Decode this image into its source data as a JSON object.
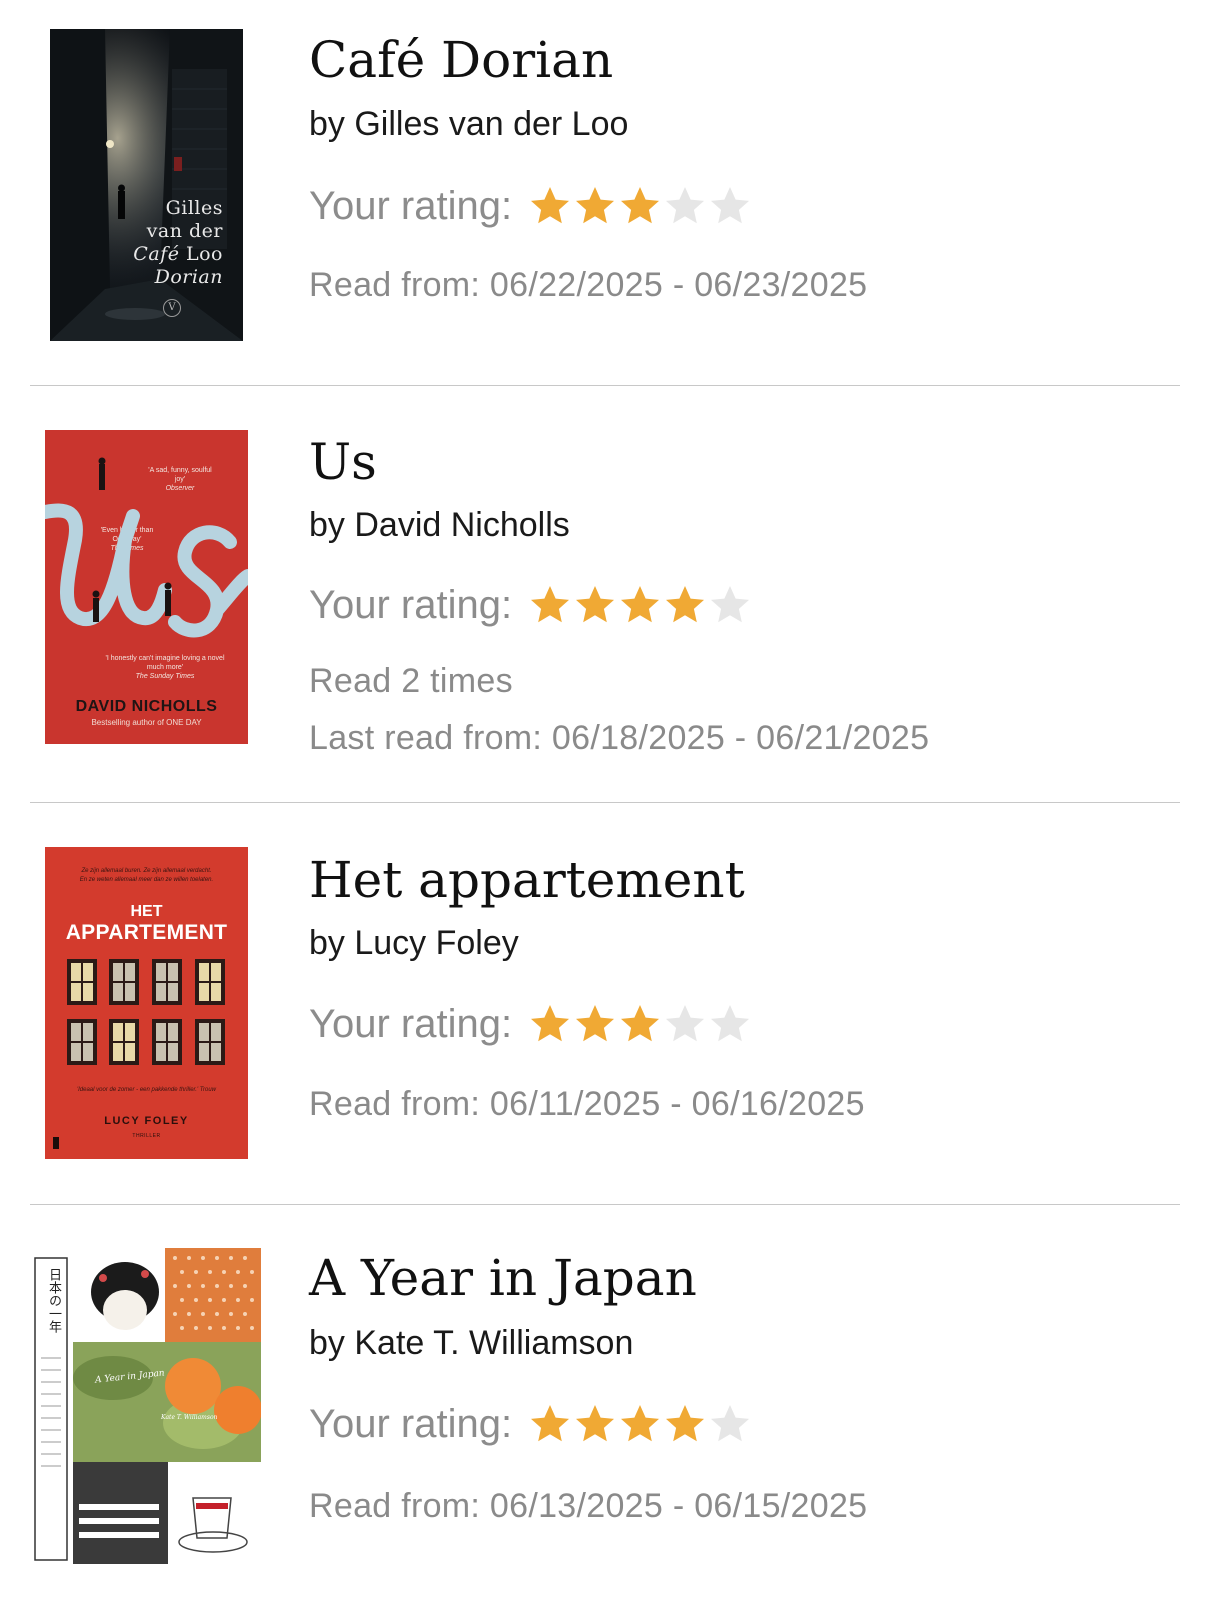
{
  "colors": {
    "star_filled": "#f0a934",
    "star_empty": "#e6e6e6",
    "divider": "#c8c8c8"
  },
  "books": [
    {
      "title": "Café Dorian",
      "author": "by Gilles van der Loo",
      "rating_label": "Your rating:",
      "rating": 3,
      "rating_max": 5,
      "read_info": "Read from: 06/22/2025 - 06/23/2025",
      "cover": {
        "author_line1": "Gilles",
        "author_line2": "van der",
        "title_line1": "Café",
        "author_line3": "Loo",
        "title_line2": "Dorian",
        "publisher_mark": "V"
      }
    },
    {
      "title": "Us",
      "author": "by David Nicholls",
      "rating_label": "Your rating:",
      "rating": 4,
      "rating_max": 5,
      "read_count": "Read 2 times",
      "read_info": "Last read from: 06/18/2025 - 06/21/2025",
      "cover": {
        "quote1": "'A sad, funny, soulful joy'",
        "quote1_source": "Observer",
        "quote2": "'Even better than One Day'",
        "quote2_source": "The Times",
        "big_title": "Us",
        "quote3": "'I honestly can't imagine loving a novel much more'",
        "quote3_source": "The Sunday Times",
        "author": "DAVID NICHOLLS",
        "tagline": "Bestselling author of ONE DAY"
      }
    },
    {
      "title": "Het appartement",
      "author": "by Lucy Foley",
      "rating_label": "Your rating:",
      "rating": 3,
      "rating_max": 5,
      "read_info": "Read from: 06/11/2025 - 06/16/2025",
      "cover": {
        "top_text": "Ze zijn allemaal buren. Ze zijn allemaal verdacht.",
        "top_text2": "En ze weten allemaal meer dan ze willen toelaten.",
        "title_line1": "HET",
        "title_line2": "APPARTEMENT",
        "blurb": "'Ideaal voor de zomer - een pakkende thriller.' Trouw",
        "author": "LUCY FOLEY",
        "genre": "THRILLER"
      }
    },
    {
      "title": "A Year in Japan",
      "author": "by Kate T. Williamson",
      "rating_label": "Your rating:",
      "rating": 4,
      "rating_max": 5,
      "read_info": "Read from: 06/13/2025 - 06/15/2025",
      "cover": {
        "side_title": "日本の一年",
        "script_title": "A Year in Japan",
        "script_author": "Kate T. Williamson"
      }
    }
  ]
}
